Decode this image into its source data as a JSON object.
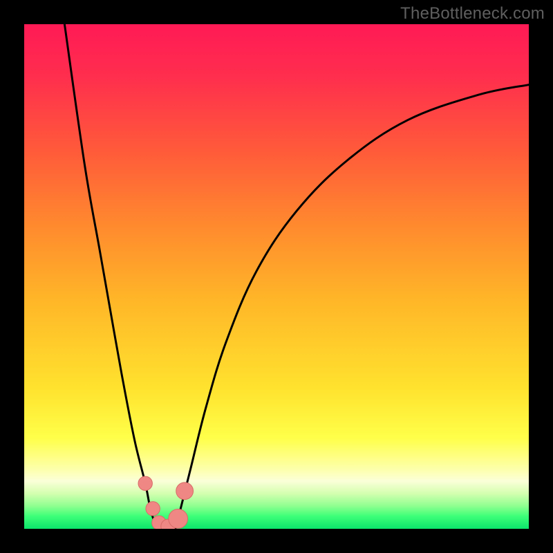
{
  "watermark": "TheBottleneck.com",
  "colors": {
    "black": "#000000",
    "curve": "#000000",
    "gradient_stops": [
      {
        "pos": 0.0,
        "color": "#ff1a55"
      },
      {
        "pos": 0.1,
        "color": "#ff2d4e"
      },
      {
        "pos": 0.25,
        "color": "#ff5a3a"
      },
      {
        "pos": 0.4,
        "color": "#ff8a2e"
      },
      {
        "pos": 0.55,
        "color": "#ffb728"
      },
      {
        "pos": 0.72,
        "color": "#ffe22e"
      },
      {
        "pos": 0.82,
        "color": "#ffff49"
      },
      {
        "pos": 0.88,
        "color": "#fdffa8"
      },
      {
        "pos": 0.905,
        "color": "#fbffd8"
      },
      {
        "pos": 0.93,
        "color": "#d4ffb0"
      },
      {
        "pos": 0.955,
        "color": "#8eff90"
      },
      {
        "pos": 0.975,
        "color": "#3dff78"
      },
      {
        "pos": 1.0,
        "color": "#0be46b"
      }
    ],
    "marker_fill": "#ef8784",
    "marker_stroke": "#d86b68"
  },
  "chart_data": {
    "type": "line",
    "title": "",
    "xlabel": "",
    "ylabel": "",
    "xlim": [
      0,
      100
    ],
    "ylim": [
      0,
      100
    ],
    "series": [
      {
        "name": "bottleneck-left",
        "x": [
          8,
          12,
          15,
          18,
          20,
          22,
          24,
          25,
          26,
          27
        ],
        "y": [
          100,
          72,
          55,
          38,
          27,
          17,
          9,
          4,
          1,
          0
        ]
      },
      {
        "name": "bottleneck-right",
        "x": [
          30,
          31,
          33,
          36,
          40,
          46,
          54,
          64,
          76,
          90,
          100
        ],
        "y": [
          0,
          4,
          12,
          24,
          37,
          51,
          63,
          73,
          81,
          86,
          88
        ]
      }
    ],
    "markers": [
      {
        "x": 24.0,
        "y": 9.0,
        "r": 1.4
      },
      {
        "x": 25.5,
        "y": 4.0,
        "r": 1.4
      },
      {
        "x": 26.7,
        "y": 1.2,
        "r": 1.4
      },
      {
        "x": 28.5,
        "y": 0.5,
        "r": 1.4
      },
      {
        "x": 30.5,
        "y": 2.0,
        "r": 1.9
      },
      {
        "x": 31.8,
        "y": 7.5,
        "r": 1.7
      }
    ],
    "note": "x is arbitrary horizontal position (0–100, left→right). y is bottleneck percentage (0 at bottom → 100 at top). Dip minimum near x≈28."
  }
}
